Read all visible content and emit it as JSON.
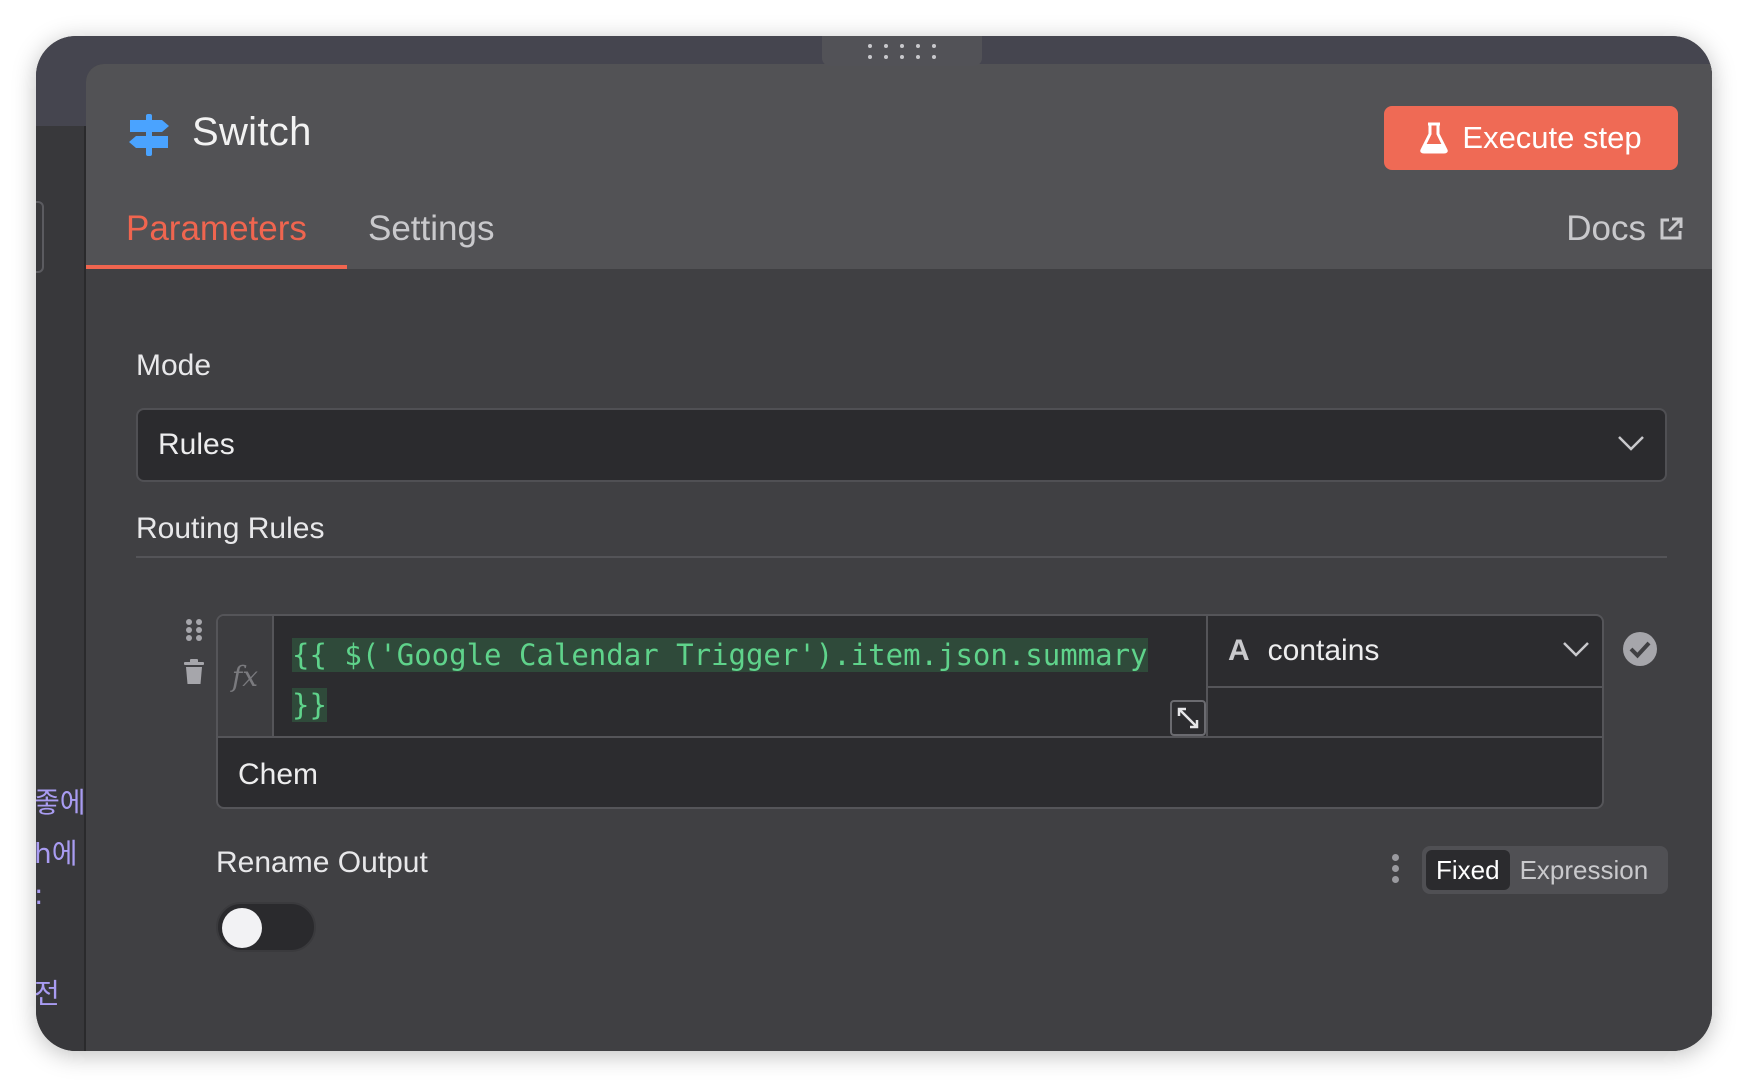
{
  "node": {
    "title": "Switch",
    "execute_label": "Execute step"
  },
  "tabs": [
    {
      "label": "Parameters",
      "active": true
    },
    {
      "label": "Settings",
      "active": false
    }
  ],
  "docs_label": "Docs",
  "mode": {
    "label": "Mode",
    "value": "Rules"
  },
  "routing": {
    "label": "Routing Rules",
    "rule": {
      "fx_label": "fx",
      "expression_line1": "{{ $('Google Calendar Trigger').item.json.summary",
      "expression_line2": "}}",
      "operator_type_icon": "A",
      "operator": "contains",
      "value": "Chem"
    }
  },
  "rename_output": {
    "label": "Rename Output",
    "enabled": false,
    "mode_options": [
      "Fixed",
      "Expression"
    ],
    "selected_mode": "Fixed"
  },
  "background_text": [
    "좋에",
    "h에",
    ":",
    "전"
  ],
  "colors": {
    "accent": "#f0654f",
    "execute_button": "#ef6a55",
    "node_icon": "#4aa3ff",
    "expression_text": "#5fd38b",
    "background_korean_text": "#a99cf2"
  }
}
